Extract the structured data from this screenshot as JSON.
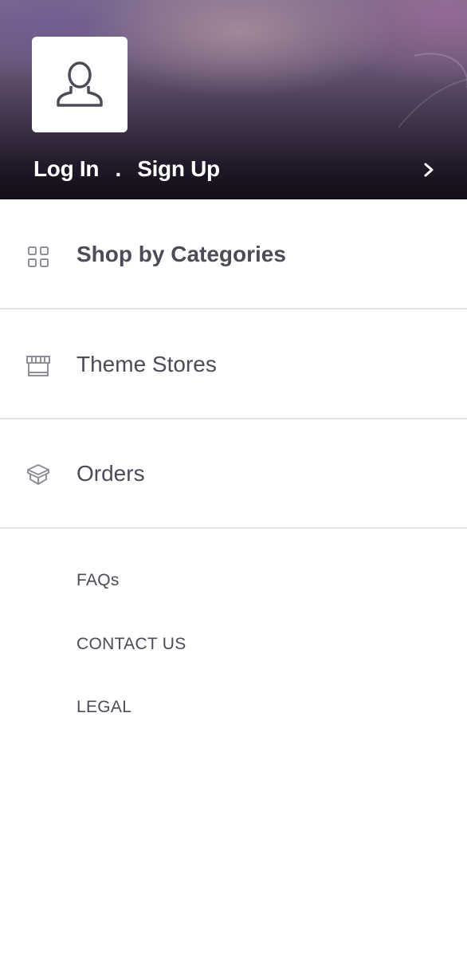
{
  "header": {
    "login_label": "Log In",
    "separator": ".",
    "signup_label": "Sign Up",
    "avatar_icon": "user-icon",
    "chevron_icon": "chevron-right-icon"
  },
  "menu": {
    "items": [
      {
        "label": "Shop by Categories",
        "icon": "grid-icon",
        "bold": true
      },
      {
        "label": "Theme Stores",
        "icon": "store-icon",
        "bold": false
      },
      {
        "label": "Orders",
        "icon": "box-icon",
        "bold": false
      }
    ]
  },
  "footer": {
    "links": [
      "FAQs",
      "CONTACT US",
      "LEGAL"
    ]
  },
  "colors": {
    "text": "#4b4c57",
    "icon": "#8e8f98",
    "divider": "#e4e4e6",
    "header_dark": "#120e18",
    "header_light": "#7d6a8a"
  }
}
